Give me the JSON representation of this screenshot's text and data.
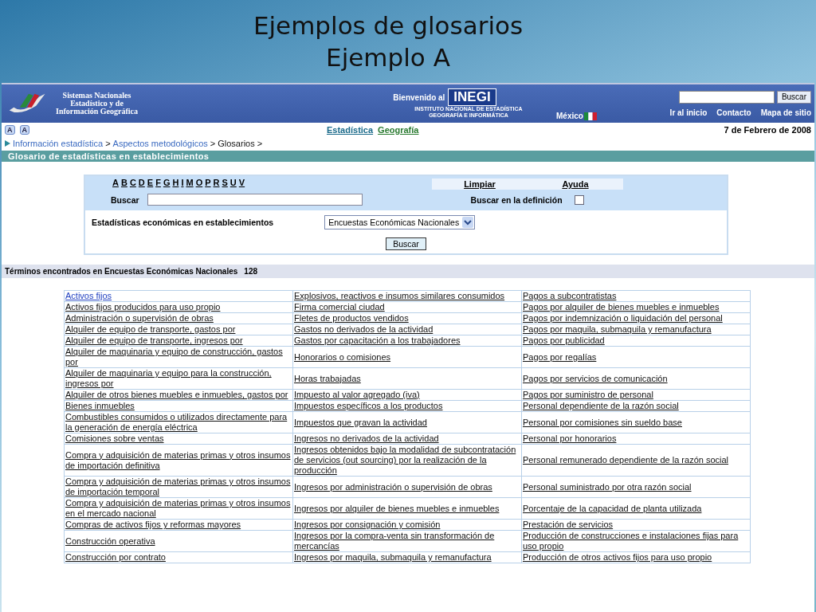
{
  "slide": {
    "title_lines": [
      "Ejemplos de glosarios",
      "Ejemplo A"
    ]
  },
  "header": {
    "system_lines": [
      "Sistemas Nacionales",
      "Estadístico y de",
      "Información Geográfica"
    ],
    "welcome": "Bienvenido al",
    "logo_text": "INEGI",
    "institute_lines": [
      "INSTITUTO NACIONAL DE ESTADÍSTICA",
      "GEOGRAFÍA E INFORMÁTICA"
    ],
    "country": "México",
    "search_button": "Buscar",
    "links": [
      "Ir al inicio",
      "Contacto",
      "Mapa de sitio"
    ]
  },
  "toolbar": {
    "font_buttons": [
      "A",
      "A"
    ],
    "nav": [
      {
        "label": "Estadística",
        "selected": true
      },
      {
        "label": "Geografía",
        "selected": false
      }
    ],
    "date": "7 de Febrero de 2008"
  },
  "breadcrumb": {
    "items": [
      "Información estadística",
      "Aspectos metodológicos",
      "Glosarios"
    ],
    "separator": ">"
  },
  "section_title": "Glosario de estadísticas en establecimientos",
  "form": {
    "letters": [
      "A",
      "B",
      "C",
      "D",
      "E",
      "F",
      "G",
      "H",
      "I",
      "M",
      "O",
      "P",
      "R",
      "S",
      "U",
      "V"
    ],
    "actions": [
      "Limpiar",
      "Ayuda"
    ],
    "search_label": "Buscar",
    "definition_label": "Buscar en la definición",
    "definition_checked": false,
    "category_label": "Estadísticas económicas en establecimientos",
    "category_value": "Encuestas Económicas Nacionales",
    "submit": "Buscar"
  },
  "results": {
    "label": "Términos encontrados en Encuestas Económicas Nacionales",
    "count": "128"
  },
  "table": {
    "rows": [
      [
        {
          "text": "Activos fijos",
          "selected": true
        },
        {
          "text": "Explosivos, reactivos e insumos similares consumidos",
          "selected": false
        },
        {
          "text": "Pagos a subcontratistas",
          "selected": false
        }
      ],
      [
        {
          "text": "Activos fijos producidos para uso propio",
          "selected": false
        },
        {
          "text": "Firma comercial ciudad",
          "selected": false
        },
        {
          "text": "Pagos por alquiler de bienes muebles e inmuebles",
          "selected": false
        }
      ],
      [
        {
          "text": "Administración o supervisión de obras",
          "selected": false
        },
        {
          "text": "Fletes de productos vendidos",
          "selected": false
        },
        {
          "text": "Pagos por indemnización o liquidación del personal",
          "selected": false
        }
      ],
      [
        {
          "text": "Alquiler de equipo de transporte, gastos por",
          "selected": false
        },
        {
          "text": "Gastos no derivados de la actividad",
          "selected": false
        },
        {
          "text": "Pagos por maquila, submaquila y remanufactura",
          "selected": false
        }
      ],
      [
        {
          "text": "Alquiler de equipo de transporte, ingresos por",
          "selected": false
        },
        {
          "text": "Gastos por capacitación a los trabajadores",
          "selected": false
        },
        {
          "text": "Pagos por publicidad",
          "selected": false
        }
      ],
      [
        {
          "text": "Alquiler de maquinaria y equipo de construcción, gastos por",
          "selected": false
        },
        {
          "text": "Honorarios o comisiones",
          "selected": false
        },
        {
          "text": "Pagos por regalías",
          "selected": false
        }
      ],
      [
        {
          "text": "Alquiler de maquinaria y equipo para la construcción, ingresos por",
          "selected": false
        },
        {
          "text": "Horas trabajadas",
          "selected": false
        },
        {
          "text": "Pagos por servicios de comunicación",
          "selected": false
        }
      ],
      [
        {
          "text": "Alquiler de otros bienes muebles e inmuebles, gastos por",
          "selected": false
        },
        {
          "text": "Impuesto al valor agregado (iva)",
          "selected": false
        },
        {
          "text": "Pagos por suministro de personal",
          "selected": false
        }
      ],
      [
        {
          "text": "Bienes inmuebles",
          "selected": false
        },
        {
          "text": "Impuestos específicos a los productos",
          "selected": false
        },
        {
          "text": "Personal dependiente de la razón social",
          "selected": false
        }
      ],
      [
        {
          "text": "Combustibles consumidos o utilizados directamente para la generación de energía eléctrica",
          "selected": false
        },
        {
          "text": "Impuestos que gravan la actividad",
          "selected": false
        },
        {
          "text": "Personal por comisiones sin sueldo base",
          "selected": false
        }
      ],
      [
        {
          "text": "Comisiones sobre ventas",
          "selected": false
        },
        {
          "text": "Ingresos no derivados de la actividad",
          "selected": false
        },
        {
          "text": "Personal por honorarios",
          "selected": false
        }
      ],
      [
        {
          "text": "Compra y adquisición de materias primas y otros insumos de importación definitiva",
          "selected": false
        },
        {
          "text": "Ingresos obtenidos bajo la modalidad de subcontratación de servicios (out sourcing) por la realización de la producción",
          "selected": false
        },
        {
          "text": "Personal remunerado dependiente de la razón social",
          "selected": false
        }
      ],
      [
        {
          "text": "Compra y adquisición de materias primas y otros insumos de importación temporal",
          "selected": false
        },
        {
          "text": "Ingresos por administración o supervisión de obras",
          "selected": false
        },
        {
          "text": "Personal suministrado por otra razón social",
          "selected": false
        }
      ],
      [
        {
          "text": "Compra y adquisición de materias primas y otros insumos en el mercado nacional",
          "selected": false
        },
        {
          "text": "Ingresos por alquiler de bienes muebles e inmuebles",
          "selected": false
        },
        {
          "text": "Porcentaje de la capacidad de planta utilizada",
          "selected": false
        }
      ],
      [
        {
          "text": "Compras de activos fijos y reformas mayores",
          "selected": false
        },
        {
          "text": "Ingresos por consignación y comisión",
          "selected": false
        },
        {
          "text": "Prestación de servicios",
          "selected": false
        }
      ],
      [
        {
          "text": "Construcción operativa",
          "selected": false
        },
        {
          "text": "Ingresos por la compra-venta sin transformación de mercancías",
          "selected": false
        },
        {
          "text": "Producción de construcciones e instalaciones fijas para uso propio",
          "selected": false
        }
      ],
      [
        {
          "text": "Construcción por contrato",
          "selected": false
        },
        {
          "text": "Ingresos por maquila, submaquila y remanufactura",
          "selected": false
        },
        {
          "text": "Producción de otros activos fijos para uso propio",
          "selected": false
        }
      ]
    ]
  }
}
